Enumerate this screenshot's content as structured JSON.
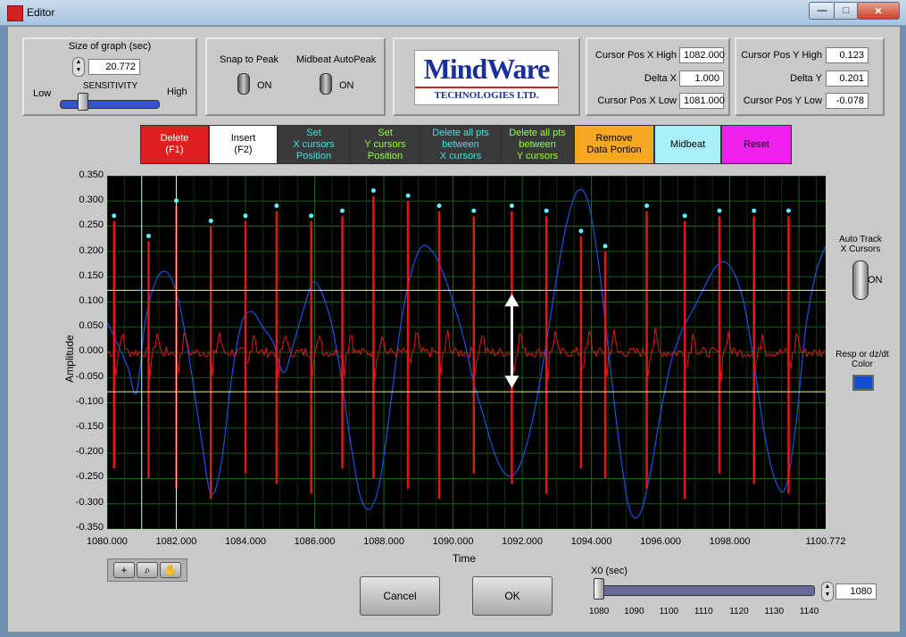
{
  "window": {
    "title": "Editor",
    "minimize": "—",
    "maximize": "□",
    "close": "✕"
  },
  "graph_size": {
    "label": "Size of graph (sec)",
    "value": "20.772"
  },
  "sensitivity": {
    "label": "SENSITIVITY",
    "low": "Low",
    "high": "High",
    "level": 0.2
  },
  "snap": {
    "label": "Snap to Peak",
    "state": "ON"
  },
  "midbeat_autopeak": {
    "label": "Midbeat AutoPeak",
    "state": "ON"
  },
  "logo": {
    "line1": "MindWare",
    "line2": "TECHNOLOGIES LTD."
  },
  "cursor_x": {
    "high_label": "Cursor Pos X High",
    "high_value": "1082.000",
    "delta_label": "Delta X",
    "delta_value": "1.000",
    "low_label": "Cursor Pos X Low",
    "low_value": "1081.000"
  },
  "cursor_y": {
    "high_label": "Cursor Pos Y High",
    "high_value": "0.123",
    "delta_label": "Delta Y",
    "delta_value": "0.201",
    "low_label": "Cursor Pos Y Low",
    "low_value": "-0.078"
  },
  "toolbar": [
    {
      "l1": "Delete",
      "l2": "(F1)",
      "l3": ""
    },
    {
      "l1": "Insert",
      "l2": "(F2)",
      "l3": ""
    },
    {
      "l1": "Set",
      "l2": "X cursors",
      "l3": "Position"
    },
    {
      "l1": "Set",
      "l2": "Y cursors",
      "l3": "Position"
    },
    {
      "l1": "Delete all pts",
      "l2": "between",
      "l3": "X cursors"
    },
    {
      "l1": "Delete all pts",
      "l2": "between",
      "l3": "Y cursors"
    },
    {
      "l1": "Remove",
      "l2": "Data Portion",
      "l3": ""
    },
    {
      "l1": "Midbeat",
      "l2": "",
      "l3": ""
    },
    {
      "l1": "Reset",
      "l2": "",
      "l3": ""
    }
  ],
  "toolbar_colors": [
    "#e02020",
    "#ffffff",
    "#3a3a3a",
    "#3a3a3a",
    "#3a3a3a",
    "#3a3a3a",
    "#f5a623",
    "#a8f0f8",
    "#f020f0"
  ],
  "toolbar_text_colors": [
    "#ffffff",
    "#000000",
    "#40e0e0",
    "#90ff40",
    "#40e0e0",
    "#90ff40",
    "#000000",
    "#000000",
    "#000000"
  ],
  "auto_track": {
    "l1": "Auto Track",
    "l2": "X Cursors",
    "state": "ON"
  },
  "resp_color": {
    "l1": "Resp or dz/dt",
    "l2": "Color",
    "swatch": "#1050d0"
  },
  "graph": {
    "ylabel": "Amplitude",
    "xlabel": "Time",
    "yticks": [
      "0.350",
      "0.300",
      "0.250",
      "0.200",
      "0.150",
      "0.100",
      "0.050",
      "0.000",
      "-0.050",
      "-0.100",
      "-0.150",
      "-0.200",
      "-0.250",
      "-0.300",
      "-0.350"
    ],
    "xticks": [
      "1080.000",
      "1082.000",
      "1084.000",
      "1086.000",
      "1088.000",
      "1090.000",
      "1092.000",
      "1094.000",
      "1096.000",
      "1098.000",
      "1100.772"
    ],
    "ecg_color": "#e01818",
    "resp_color": "#2050e0",
    "cursor_x_color": "#c0ffff",
    "cursor_y_color": "#e0ff80",
    "peak_color": "#60f0ff"
  },
  "chart_data": {
    "type": "line",
    "xlim": [
      1080.0,
      1100.772
    ],
    "ylim": [
      -0.35,
      0.35
    ],
    "xlabel": "Time",
    "ylabel": "Amplitude",
    "grid": true,
    "series": [
      {
        "x": [
          1080.0,
          1080.35,
          1080.6,
          1080.85,
          1081.1,
          1081.4,
          1081.7,
          1082.0,
          1082.3,
          1082.7,
          1083.0,
          1083.3,
          1083.6,
          1083.9,
          1084.2,
          1084.5,
          1084.8,
          1085.1,
          1085.4,
          1085.7,
          1086.0,
          1086.4,
          1086.7,
          1087.0,
          1087.3,
          1087.6,
          1087.9,
          1088.2,
          1088.5,
          1088.8,
          1089.1,
          1089.4,
          1089.7,
          1090.0,
          1090.3,
          1090.6,
          1090.9,
          1091.2,
          1091.5,
          1091.8,
          1092.1,
          1092.4,
          1092.7,
          1093.0,
          1093.3,
          1093.6,
          1093.9,
          1094.2,
          1094.5,
          1094.8,
          1095.1,
          1095.4,
          1095.7,
          1096.0,
          1096.3,
          1096.6,
          1096.9,
          1097.2,
          1097.5,
          1097.8,
          1098.1,
          1098.4,
          1098.7,
          1099.0,
          1099.3,
          1099.6,
          1099.9,
          1100.2,
          1100.5,
          1100.772
        ],
        "y": [
          0.06,
          0.01,
          -0.03,
          -0.08,
          0.06,
          0.14,
          0.16,
          0.12,
          0.02,
          -0.16,
          -0.28,
          -0.22,
          -0.05,
          0.06,
          0.08,
          0.05,
          0.02,
          -0.04,
          0.02,
          0.09,
          0.14,
          0.08,
          -0.02,
          -0.16,
          -0.28,
          -0.31,
          -0.25,
          -0.1,
          0.06,
          0.16,
          0.21,
          0.2,
          0.16,
          0.1,
          0.03,
          -0.06,
          -0.13,
          -0.2,
          -0.24,
          -0.24,
          -0.19,
          -0.1,
          0.02,
          0.15,
          0.26,
          0.32,
          0.3,
          0.18,
          0.0,
          -0.18,
          -0.31,
          -0.32,
          -0.24,
          -0.12,
          -0.02,
          0.04,
          0.08,
          0.12,
          0.16,
          0.18,
          0.16,
          0.1,
          -0.02,
          -0.16,
          -0.25,
          -0.27,
          -0.15,
          0.05,
          0.16,
          0.21
        ]
      }
    ],
    "ecg_r_peaks_x": [
      1080.2,
      1081.2,
      1082.0,
      1083.0,
      1084.0,
      1084.9,
      1085.9,
      1086.8,
      1087.7,
      1088.7,
      1089.6,
      1090.6,
      1091.7,
      1092.7,
      1093.7,
      1094.4,
      1095.6,
      1096.7,
      1097.7,
      1098.7,
      1099.7
    ],
    "ecg_r_peaks_y": [
      0.26,
      0.22,
      0.29,
      0.25,
      0.26,
      0.28,
      0.26,
      0.27,
      0.31,
      0.3,
      0.28,
      0.27,
      0.28,
      0.27,
      0.23,
      0.2,
      0.28,
      0.26,
      0.27,
      0.27,
      0.27
    ],
    "cursor_x": [
      1081.0,
      1082.0
    ],
    "cursor_y": [
      0.123,
      -0.078
    ]
  },
  "x0": {
    "label": "X0 (sec)",
    "value": "1080",
    "level": 0.0,
    "ticks": [
      "1080",
      "1090",
      "1100",
      "1110",
      "1120",
      "1130",
      "1140"
    ]
  },
  "buttons": {
    "cancel": "Cancel",
    "ok": "OK"
  },
  "tools": {
    "t1": "+",
    "t2": "⌕",
    "t3": "✋"
  }
}
